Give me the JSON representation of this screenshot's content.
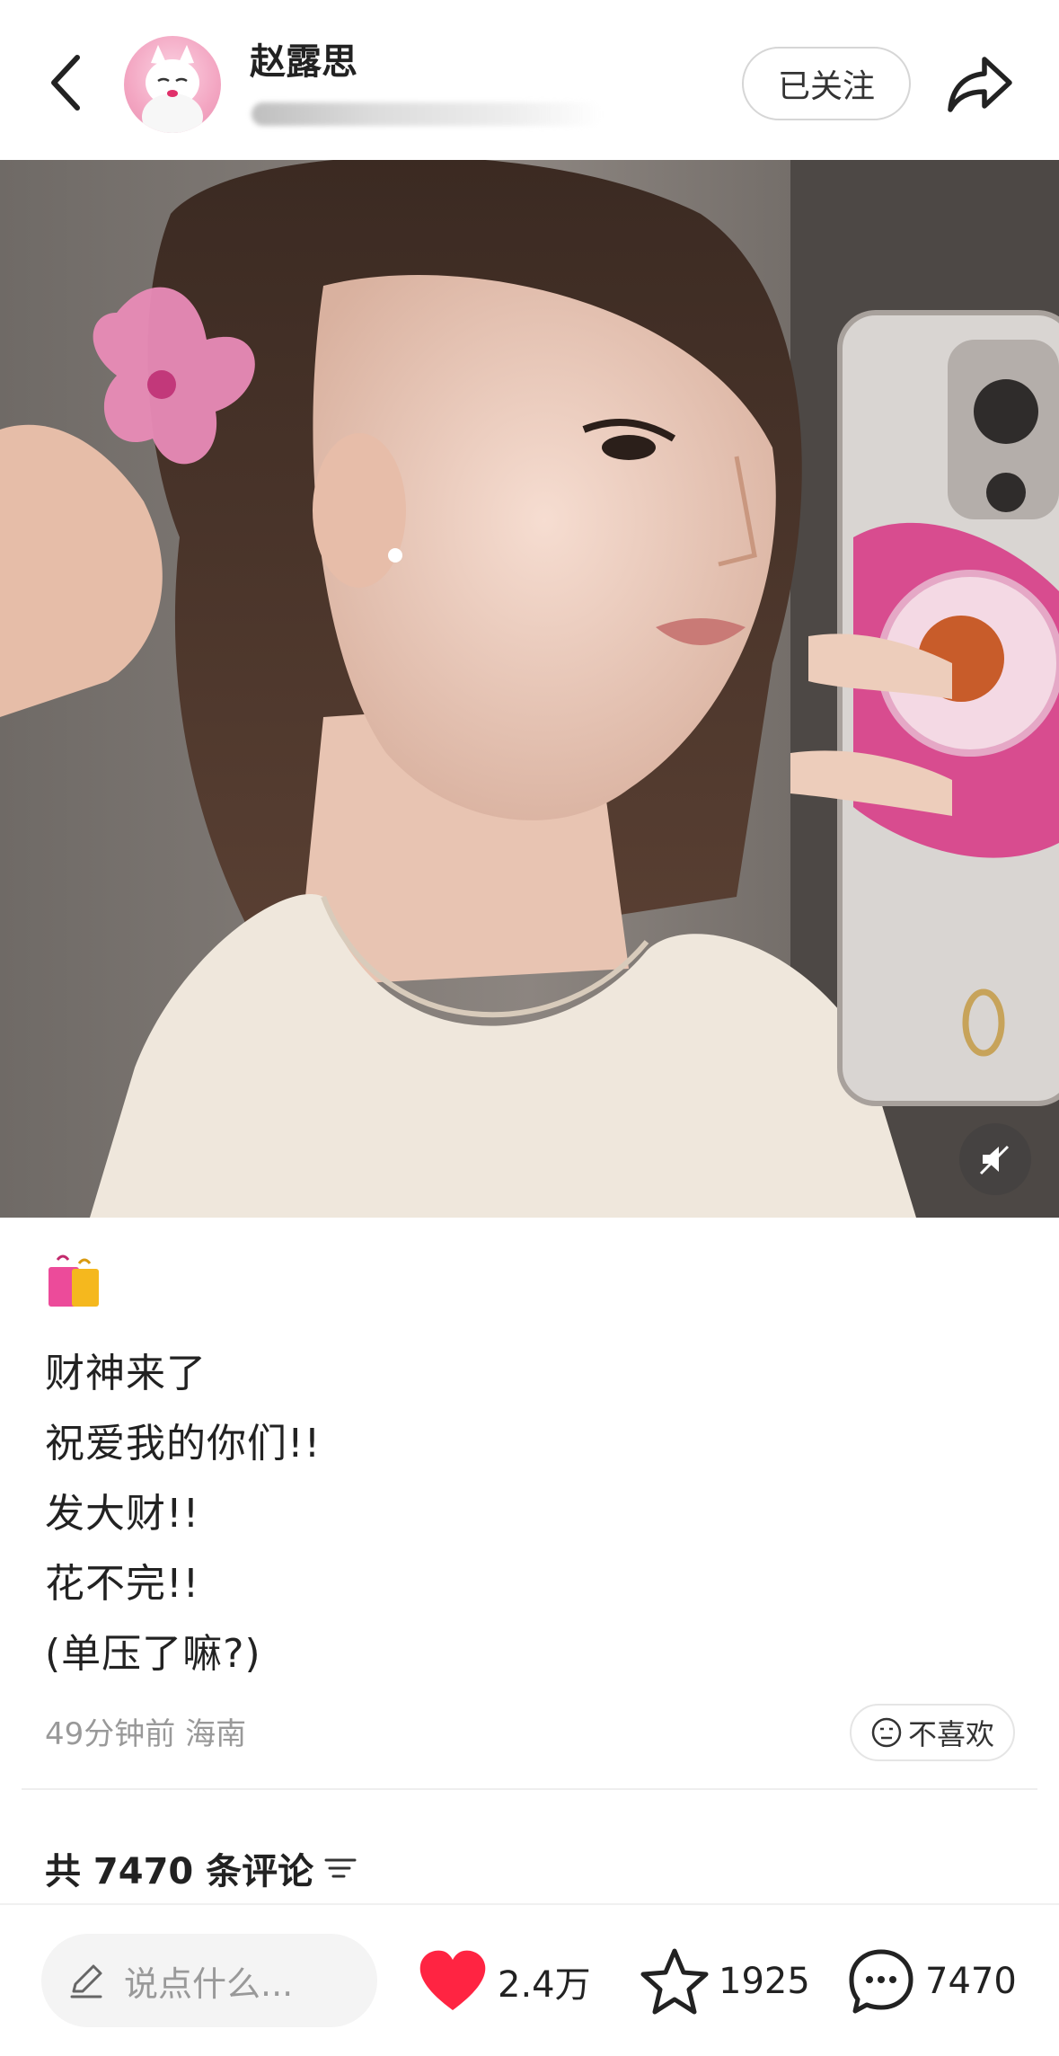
{
  "header": {
    "username": "赵露思",
    "follow_label": "已关注",
    "back_icon": "chevron-left-icon",
    "share_icon": "share-arrow-icon"
  },
  "photo": {
    "description_icon": "mute-icon"
  },
  "post": {
    "emoji": "shopping-bags-emoji",
    "lines": [
      "财神来了",
      "祝爱我的你们!!",
      "发大财!!",
      "花不完!!",
      "(单压了嘛?)"
    ],
    "meta": "49分钟前 海南",
    "dislike_label": "不喜欢"
  },
  "comments": {
    "header": "共 7470 条评论"
  },
  "bottom_bar": {
    "input_placeholder": "说点什么...",
    "likes": "2.4万",
    "favorites": "1925",
    "comments": "7470"
  },
  "colors": {
    "like_red": "#ff2442",
    "text_dark": "#222222",
    "text_grey": "#999999"
  }
}
